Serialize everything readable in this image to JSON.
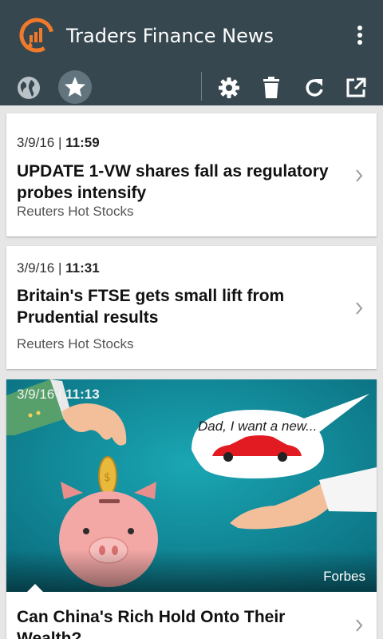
{
  "app": {
    "title": "Traders Finance News",
    "colors": {
      "appbar": "#37474f",
      "logo_orange": "#f07a2a",
      "background": "#e6e6e6"
    }
  },
  "toolbar": {
    "left_icons": [
      "globe-icon",
      "star-icon"
    ],
    "right_icons": [
      "gear-icon",
      "trash-icon",
      "refresh-icon",
      "open-external-icon"
    ],
    "selected": "star-icon"
  },
  "articles": [
    {
      "date": "3/9/16 |",
      "time": "11:59",
      "title": "UPDATE 1-VW shares fall as regulatory probes intensify",
      "source": "Reuters Hot Stocks"
    },
    {
      "date": "3/9/16 |",
      "time": "11:31",
      "title": "Britain's FTSE gets small lift from Prudential results",
      "source": "Reuters Hot Stocks"
    },
    {
      "date": "3/9/16 |",
      "time": "11:13",
      "title": "Can China's Rich Hold Onto Their Wealth?",
      "source": "Forbes",
      "image_caption": "Dad, I want a new..."
    }
  ]
}
